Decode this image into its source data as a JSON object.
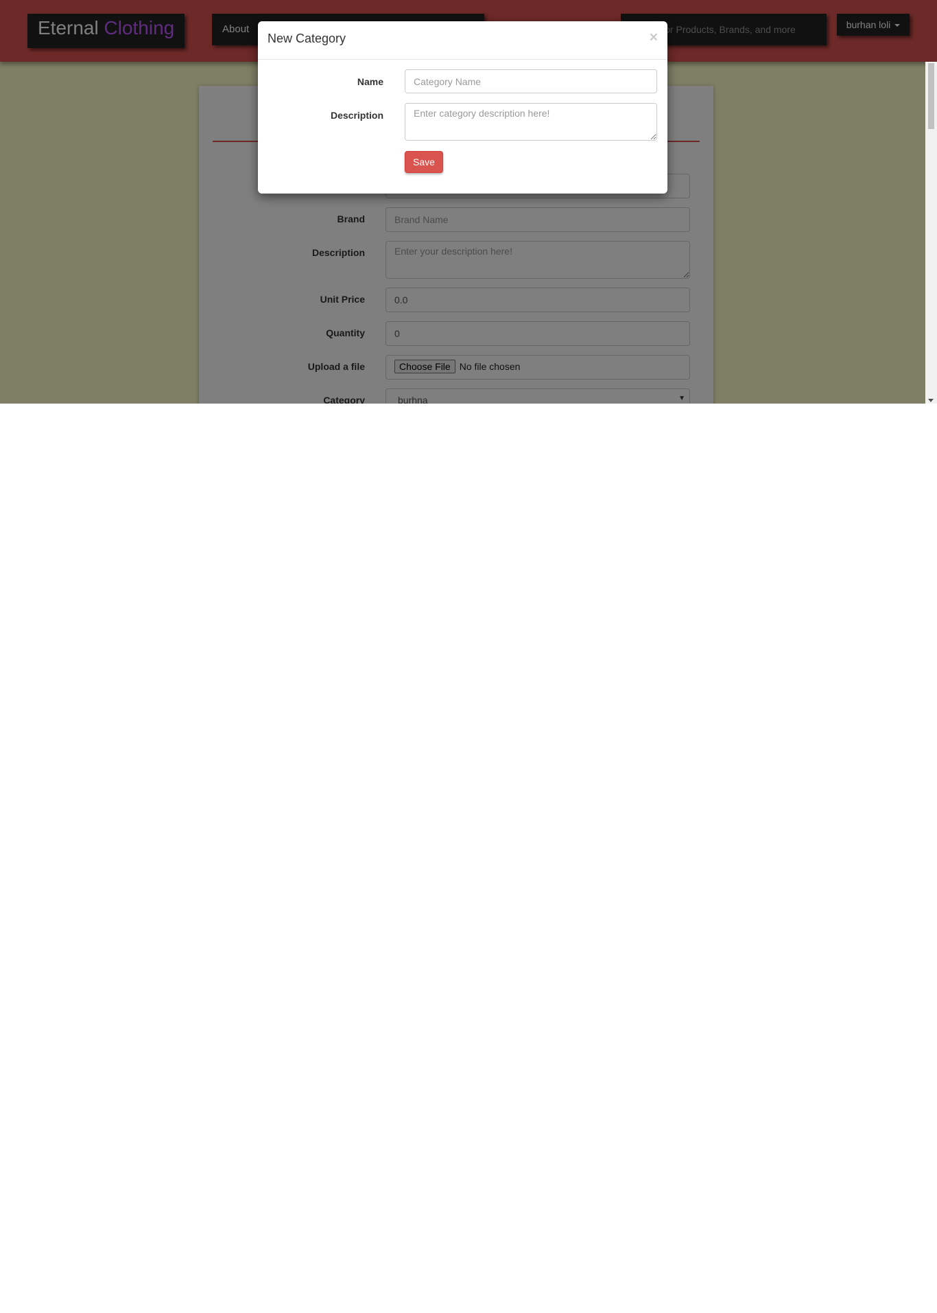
{
  "navbar": {
    "brand_part1": "Eternal",
    "brand_part2": "Clothing",
    "links": [
      "About"
    ],
    "search_placeholder": "Search for Products, Brands, and more",
    "user_name": "burhan loli"
  },
  "product_form": {
    "brand_label": "Brand",
    "brand_placeholder": "Brand Name",
    "description_label": "Description",
    "description_placeholder": "Enter your description here!",
    "unit_price_label": "Unit Price",
    "unit_price_value": "0.0",
    "quantity_label": "Quantity",
    "quantity_value": "0",
    "upload_label": "Upload a file",
    "choose_file_label": "Choose File",
    "file_status": "No file chosen",
    "category_label": "Category",
    "category_value": "burhna"
  },
  "modal": {
    "title": "New Category",
    "close_symbol": "×",
    "name_label": "Name",
    "name_placeholder": "Category Name",
    "description_label": "Description",
    "description_placeholder": "Enter category description here!",
    "save_label": "Save"
  },
  "colors": {
    "navbar": "#d9534f",
    "page_background": "#ffffcc",
    "dark_box": "#222222",
    "brand_accent": "#c158ff",
    "save_button": "#d9534f"
  }
}
